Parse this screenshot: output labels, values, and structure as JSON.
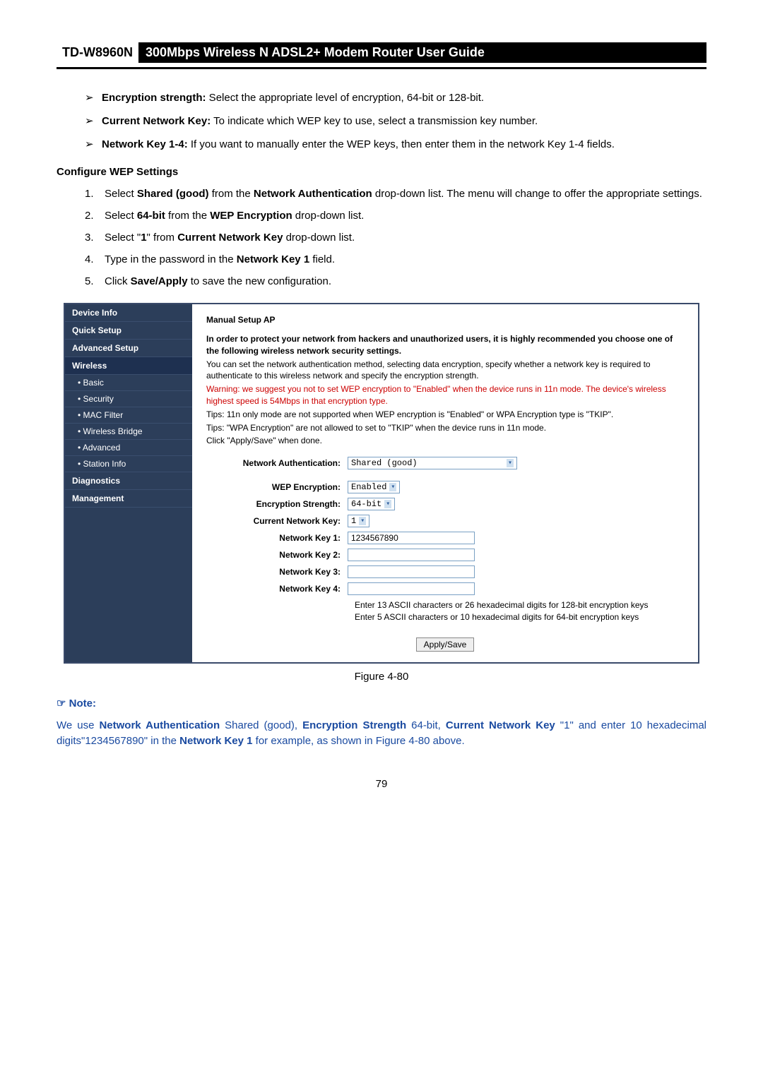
{
  "header": {
    "model": "TD-W8960N",
    "title": "300Mbps Wireless N ADSL2+ Modem Router User Guide"
  },
  "bullets": [
    {
      "label": "Encryption strength:",
      "text": " Select the appropriate level of encryption, 64-bit or 128-bit."
    },
    {
      "label": "Current Network Key:",
      "text": " To indicate which WEP key to use, select a transmission key number."
    },
    {
      "label": "Network Key 1-4:",
      "text": " If you want to manually enter the WEP keys, then enter them in the network Key 1-4 fields."
    }
  ],
  "configure_title": "Configure WEP Settings",
  "steps": [
    {
      "num": "1.",
      "pre": "Select ",
      "b1": "Shared (good)",
      "mid": " from the ",
      "b2": "Network Authentication",
      "post": " drop-down list. The menu will change to offer the appropriate settings."
    },
    {
      "num": "2.",
      "pre": "Select ",
      "b1": "64-bit",
      "mid": " from the ",
      "b2": "WEP Encryption",
      "post": " drop-down list."
    },
    {
      "num": "3.",
      "pre": "Select \"",
      "b1": "1",
      "mid": "\" from ",
      "b2": "Current Network Key",
      "post": " drop-down list."
    },
    {
      "num": "4.",
      "pre": "Type in the password in the ",
      "b1": "Network Key 1",
      "mid": "",
      "b2": "",
      "post": " field."
    },
    {
      "num": "5.",
      "pre": "Click ",
      "b1": "Save/Apply",
      "mid": "",
      "b2": "",
      "post": " to save the new configuration."
    }
  ],
  "sidebar": {
    "items": [
      {
        "label": "Device Info",
        "sub": false
      },
      {
        "label": "Quick Setup",
        "sub": false
      },
      {
        "label": "Advanced Setup",
        "sub": false
      },
      {
        "label": "Wireless",
        "sub": false,
        "selected": true
      },
      {
        "label": "• Basic",
        "sub": true
      },
      {
        "label": "• Security",
        "sub": true
      },
      {
        "label": "• MAC Filter",
        "sub": true
      },
      {
        "label": "• Wireless Bridge",
        "sub": true
      },
      {
        "label": "• Advanced",
        "sub": true
      },
      {
        "label": "• Station Info",
        "sub": true
      },
      {
        "label": "Diagnostics",
        "sub": false
      },
      {
        "label": "Management",
        "sub": false
      }
    ]
  },
  "panel": {
    "heading": "Manual Setup AP",
    "p1": "In order to protect your network from hackers and unauthorized users, it is highly recommended you choose one of the following wireless network security settings.",
    "p2": "You can set the network authentication method, selecting data encryption, specify whether a network key is required to authenticate to this wireless network and specify the encryption strength.",
    "warn": "Warning: we suggest you not to set WEP encryption to \"Enabled\" when the device runs in 11n mode. The device's wireless highest speed is 54Mbps in that encryption type.",
    "p3": "Tips: 11n only mode are not supported when WEP encryption is \"Enabled\" or WPA Encryption type is \"TKIP\".",
    "p4": "Tips: \"WPA Encryption\" are not allowed to set to \"TKIP\" when the device runs in 11n mode.",
    "p5": "Click \"Apply/Save\" when done.",
    "labels": {
      "auth": "Network Authentication:",
      "wep": "WEP Encryption:",
      "strength": "Encryption Strength:",
      "curkey": "Current Network Key:",
      "key1": "Network Key 1:",
      "key2": "Network Key 2:",
      "key3": "Network Key 3:",
      "key4": "Network Key 4:"
    },
    "values": {
      "auth": "Shared (good)",
      "wep": "Enabled",
      "strength": "64-bit",
      "curkey": "1",
      "key1": "1234567890",
      "key2": "",
      "key3": "",
      "key4": ""
    },
    "hint1": "Enter 13 ASCII characters or 26 hexadecimal digits for 128-bit encryption keys",
    "hint2": "Enter 5 ASCII characters or 10 hexadecimal digits for 64-bit encryption keys",
    "apply": "Apply/Save"
  },
  "figure_caption": "Figure 4-80",
  "note_label": "☞ Note:",
  "note": {
    "t1": "We use ",
    "b1": "Network Authentication",
    "t2": " Shared (good), ",
    "b2": "Encryption Strength",
    "t3": " 64-bit, ",
    "b3": "Current Network Key",
    "t4": " \"1\" and enter 10 hexadecimal digits\"1234567890\" in the ",
    "b4": "Network Key 1",
    "t5": " for example, as shown in Figure 4-80 above."
  },
  "page_number": "79"
}
